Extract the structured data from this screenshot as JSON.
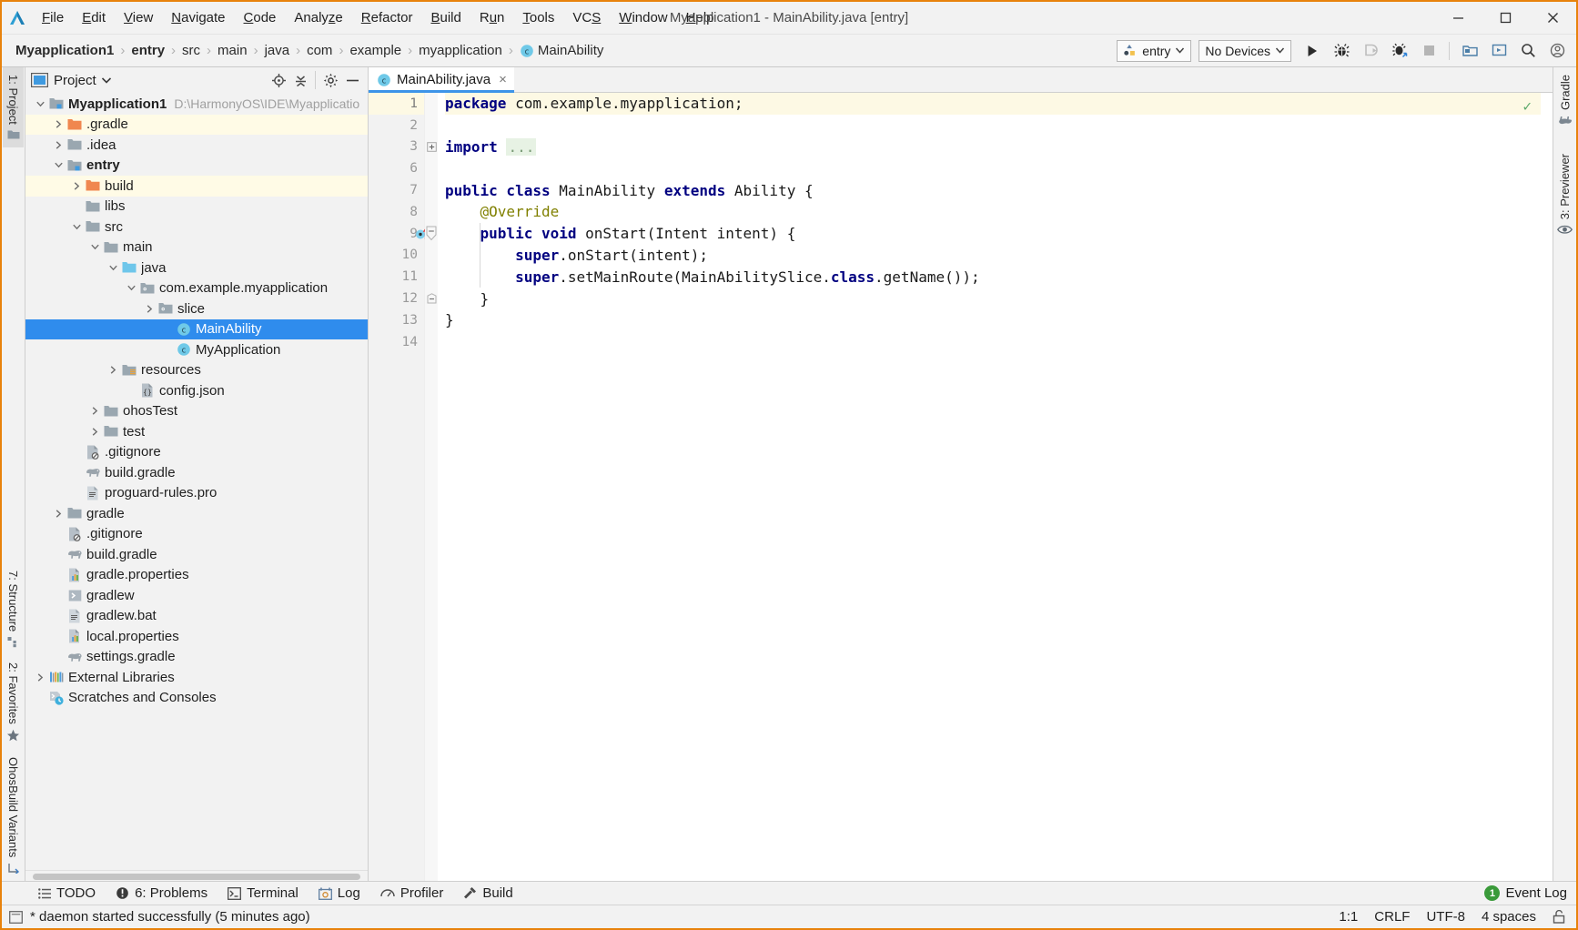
{
  "window": {
    "title": "Myapplication1 - MainAbility.java [entry]",
    "minimize_label": "Minimize",
    "maximize_label": "Maximize",
    "close_label": "Close"
  },
  "menubar": {
    "items": [
      {
        "label": "File",
        "mnemonic": "F"
      },
      {
        "label": "Edit",
        "mnemonic": "E"
      },
      {
        "label": "View",
        "mnemonic": "V"
      },
      {
        "label": "Navigate",
        "mnemonic": "N"
      },
      {
        "label": "Code",
        "mnemonic": "C"
      },
      {
        "label": "Analyze",
        "mnemonic": "z"
      },
      {
        "label": "Refactor",
        "mnemonic": "R"
      },
      {
        "label": "Build",
        "mnemonic": "B"
      },
      {
        "label": "Run",
        "mnemonic": "u"
      },
      {
        "label": "Tools",
        "mnemonic": "T"
      },
      {
        "label": "VCS",
        "mnemonic": "S"
      },
      {
        "label": "Window",
        "mnemonic": "W"
      },
      {
        "label": "Help",
        "mnemonic": "H"
      }
    ]
  },
  "breadcrumbs": [
    {
      "label": "Myapplication1",
      "bold": true,
      "icon": ""
    },
    {
      "label": "entry",
      "bold": true,
      "icon": ""
    },
    {
      "label": "src",
      "bold": false,
      "icon": ""
    },
    {
      "label": "main",
      "bold": false,
      "icon": ""
    },
    {
      "label": "java",
      "bold": false,
      "icon": ""
    },
    {
      "label": "com",
      "bold": false,
      "icon": ""
    },
    {
      "label": "example",
      "bold": false,
      "icon": ""
    },
    {
      "label": "myapplication",
      "bold": false,
      "icon": ""
    },
    {
      "label": "MainAbility",
      "bold": false,
      "icon": "class-icon"
    }
  ],
  "toolbar": {
    "run_config": "entry",
    "device_selector": "No Devices",
    "run_label": "Run",
    "debug_label": "Debug",
    "attach_label": "Attach Debugger to Process",
    "profile_label": "Profile",
    "stop_label": "Stop",
    "project_structure_label": "Project Structure",
    "preview_label": "Previewer",
    "search_label": "Search Everywhere",
    "account_label": "Account"
  },
  "left_strip": {
    "tabs": [
      {
        "label": "1: Project",
        "icon": "folder-icon",
        "active": true
      },
      {
        "label": "7: Structure",
        "icon": "structure-icon",
        "active": false
      },
      {
        "label": "2: Favorites",
        "icon": "star-icon",
        "active": false
      },
      {
        "label": "OhosBuild Variants",
        "icon": "variants-icon",
        "active": false
      }
    ]
  },
  "right_strip": {
    "tabs": [
      {
        "label": "Gradle",
        "icon": "gradle-elephant-icon"
      },
      {
        "label": "3: Previewer",
        "icon": "eye-icon"
      }
    ]
  },
  "project_panel": {
    "title": "Project",
    "actions": [
      {
        "name": "locate-icon",
        "label": "Select Opened File"
      },
      {
        "name": "collapse-all-icon",
        "label": "Collapse All"
      },
      {
        "name": "gear-icon",
        "label": "Settings"
      },
      {
        "name": "hide-icon",
        "label": "Hide"
      }
    ],
    "tree": [
      {
        "indent": 0,
        "arrow": "down",
        "icon": "module-icon",
        "label": "Myapplication1",
        "bold": true,
        "sub": "D:\\HarmonyOS\\IDE\\Myapplicatio",
        "state": "normal"
      },
      {
        "indent": 1,
        "arrow": "right",
        "icon": "folder-orange-icon",
        "label": ".gradle",
        "bold": false,
        "sub": "",
        "state": "ignored"
      },
      {
        "indent": 1,
        "arrow": "right",
        "icon": "folder-icon",
        "label": ".idea",
        "bold": false,
        "sub": "",
        "state": "normal"
      },
      {
        "indent": 1,
        "arrow": "down",
        "icon": "module-icon",
        "label": "entry",
        "bold": true,
        "sub": "",
        "state": "normal"
      },
      {
        "indent": 2,
        "arrow": "right",
        "icon": "folder-orange-icon",
        "label": "build",
        "bold": false,
        "sub": "",
        "state": "ignored"
      },
      {
        "indent": 2,
        "arrow": "none",
        "icon": "folder-icon",
        "label": "libs",
        "bold": false,
        "sub": "",
        "state": "normal"
      },
      {
        "indent": 2,
        "arrow": "down",
        "icon": "folder-icon",
        "label": "src",
        "bold": false,
        "sub": "",
        "state": "normal"
      },
      {
        "indent": 3,
        "arrow": "down",
        "icon": "folder-icon",
        "label": "main",
        "bold": false,
        "sub": "",
        "state": "normal"
      },
      {
        "indent": 4,
        "arrow": "down",
        "icon": "source-root-icon",
        "label": "java",
        "bold": false,
        "sub": "",
        "state": "normal"
      },
      {
        "indent": 5,
        "arrow": "down",
        "icon": "package-icon",
        "label": "com.example.myapplication",
        "bold": false,
        "sub": "",
        "state": "normal"
      },
      {
        "indent": 6,
        "arrow": "right",
        "icon": "package-icon",
        "label": "slice",
        "bold": false,
        "sub": "",
        "state": "normal"
      },
      {
        "indent": 7,
        "arrow": "none",
        "icon": "class-icon",
        "label": "MainAbility",
        "bold": false,
        "sub": "",
        "state": "selected"
      },
      {
        "indent": 7,
        "arrow": "none",
        "icon": "class-icon",
        "label": "MyApplication",
        "bold": false,
        "sub": "",
        "state": "normal"
      },
      {
        "indent": 4,
        "arrow": "right",
        "icon": "resources-icon",
        "label": "resources",
        "bold": false,
        "sub": "",
        "state": "normal"
      },
      {
        "indent": 5,
        "arrow": "none",
        "icon": "json-file-icon",
        "label": "config.json",
        "bold": false,
        "sub": "",
        "state": "normal"
      },
      {
        "indent": 3,
        "arrow": "right",
        "icon": "folder-icon",
        "label": "ohosTest",
        "bold": false,
        "sub": "",
        "state": "normal"
      },
      {
        "indent": 3,
        "arrow": "right",
        "icon": "folder-icon",
        "label": "test",
        "bold": false,
        "sub": "",
        "state": "normal"
      },
      {
        "indent": 2,
        "arrow": "none",
        "icon": "gitignore-icon",
        "label": ".gitignore",
        "bold": false,
        "sub": "",
        "state": "normal"
      },
      {
        "indent": 2,
        "arrow": "none",
        "icon": "gradle-elephant-icon",
        "label": "build.gradle",
        "bold": false,
        "sub": "",
        "state": "normal"
      },
      {
        "indent": 2,
        "arrow": "none",
        "icon": "text-file-icon",
        "label": "proguard-rules.pro",
        "bold": false,
        "sub": "",
        "state": "normal"
      },
      {
        "indent": 1,
        "arrow": "right",
        "icon": "folder-icon",
        "label": "gradle",
        "bold": false,
        "sub": "",
        "state": "normal"
      },
      {
        "indent": 1,
        "arrow": "none",
        "icon": "gitignore-icon",
        "label": ".gitignore",
        "bold": false,
        "sub": "",
        "state": "normal"
      },
      {
        "indent": 1,
        "arrow": "none",
        "icon": "gradle-elephant-icon",
        "label": "build.gradle",
        "bold": false,
        "sub": "",
        "state": "normal"
      },
      {
        "indent": 1,
        "arrow": "none",
        "icon": "properties-icon",
        "label": "gradle.properties",
        "bold": false,
        "sub": "",
        "state": "normal"
      },
      {
        "indent": 1,
        "arrow": "none",
        "icon": "script-icon",
        "label": "gradlew",
        "bold": false,
        "sub": "",
        "state": "normal"
      },
      {
        "indent": 1,
        "arrow": "none",
        "icon": "text-file-icon",
        "label": "gradlew.bat",
        "bold": false,
        "sub": "",
        "state": "normal"
      },
      {
        "indent": 1,
        "arrow": "none",
        "icon": "properties-icon",
        "label": "local.properties",
        "bold": false,
        "sub": "",
        "state": "normal"
      },
      {
        "indent": 1,
        "arrow": "none",
        "icon": "gradle-elephant-icon",
        "label": "settings.gradle",
        "bold": false,
        "sub": "",
        "state": "normal"
      },
      {
        "indent": 0,
        "arrow": "right",
        "icon": "libraries-icon",
        "label": "External Libraries",
        "bold": false,
        "sub": "",
        "state": "normal"
      },
      {
        "indent": 0,
        "arrow": "none",
        "icon": "scratches-icon",
        "label": "Scratches and Consoles",
        "bold": false,
        "sub": "",
        "state": "normal"
      }
    ]
  },
  "editor": {
    "tabs": [
      {
        "label": "MainAbility.java",
        "icon": "class-icon",
        "active": true,
        "close": "×"
      }
    ],
    "inspection_status": "✓",
    "gutter_lines": [
      "1",
      "2",
      "3",
      "6",
      "7",
      "8",
      "9",
      "10",
      "11",
      "12",
      "13",
      "14"
    ],
    "current_line_index": 0,
    "override_marker_line": "9",
    "lines": [
      {
        "num": "1",
        "tokens": [
          {
            "t": "package",
            "c": "kw"
          },
          {
            "t": " com.example.myapplication;",
            "c": "pl"
          }
        ],
        "current": true
      },
      {
        "num": "2",
        "tokens": [],
        "current": false
      },
      {
        "num": "3",
        "tokens": [
          {
            "t": "import",
            "c": "kw"
          },
          {
            "t": " ",
            "c": "pl"
          },
          {
            "t": "...",
            "c": "fold"
          }
        ],
        "current": false,
        "fold": "plus"
      },
      {
        "num": "6",
        "tokens": [],
        "current": false
      },
      {
        "num": "7",
        "tokens": [
          {
            "t": "public class",
            "c": "kw"
          },
          {
            "t": " MainAbility ",
            "c": "pl"
          },
          {
            "t": "extends",
            "c": "kw"
          },
          {
            "t": " Ability {",
            "c": "pl"
          }
        ],
        "current": false
      },
      {
        "num": "8",
        "tokens": [
          {
            "t": "    @Override",
            "c": "ann"
          }
        ],
        "current": false
      },
      {
        "num": "9",
        "tokens": [
          {
            "t": "    ",
            "c": "pl"
          },
          {
            "t": "public void",
            "c": "kw"
          },
          {
            "t": " onStart(Intent intent) {",
            "c": "pl"
          }
        ],
        "current": false,
        "fold": "minus"
      },
      {
        "num": "10",
        "tokens": [
          {
            "t": "        ",
            "c": "pl"
          },
          {
            "t": "super",
            "c": "kw"
          },
          {
            "t": ".onStart(intent);",
            "c": "pl"
          }
        ],
        "current": false
      },
      {
        "num": "11",
        "tokens": [
          {
            "t": "        ",
            "c": "pl"
          },
          {
            "t": "super",
            "c": "kw"
          },
          {
            "t": ".setMainRoute(MainAbilitySlice.",
            "c": "pl"
          },
          {
            "t": "class",
            "c": "kw"
          },
          {
            "t": ".getName());",
            "c": "pl"
          }
        ],
        "current": false
      },
      {
        "num": "12",
        "tokens": [
          {
            "t": "    }",
            "c": "pl"
          }
        ],
        "current": false,
        "fold": "endminus"
      },
      {
        "num": "13",
        "tokens": [
          {
            "t": "}",
            "c": "pl"
          }
        ],
        "current": false
      },
      {
        "num": "14",
        "tokens": [],
        "current": false
      }
    ]
  },
  "bottom_bar": {
    "tabs": [
      {
        "label": "TODO",
        "icon": "todo-icon"
      },
      {
        "label": "6: Problems",
        "icon": "problems-icon",
        "mnemonic": "6"
      },
      {
        "label": "Terminal",
        "icon": "terminal-icon"
      },
      {
        "label": "Log",
        "icon": "log-icon"
      },
      {
        "label": "Profiler",
        "icon": "profiler-icon"
      },
      {
        "label": "Build",
        "icon": "build-hammer-icon"
      }
    ],
    "event_log": {
      "count": "1",
      "label": "Event Log"
    }
  },
  "status_bar": {
    "message": "* daemon started successfully (5 minutes ago)",
    "caret_position": "1:1",
    "line_separator": "CRLF",
    "encoding": "UTF-8",
    "indent": "4 spaces",
    "lock_label": "Read-only toggle"
  },
  "colors": {
    "accent": "#e8820c",
    "selection": "#2f8ced",
    "keyword": "#000080",
    "annotation": "#808000",
    "current_line": "#fdf9e4",
    "ignored_row": "#fffbe6",
    "success": "#59a869",
    "badge_green": "#3a9a3a",
    "folder": "#9aa7b0",
    "folder_orange": "#f0874f",
    "source_root": "#6ec6ea"
  }
}
